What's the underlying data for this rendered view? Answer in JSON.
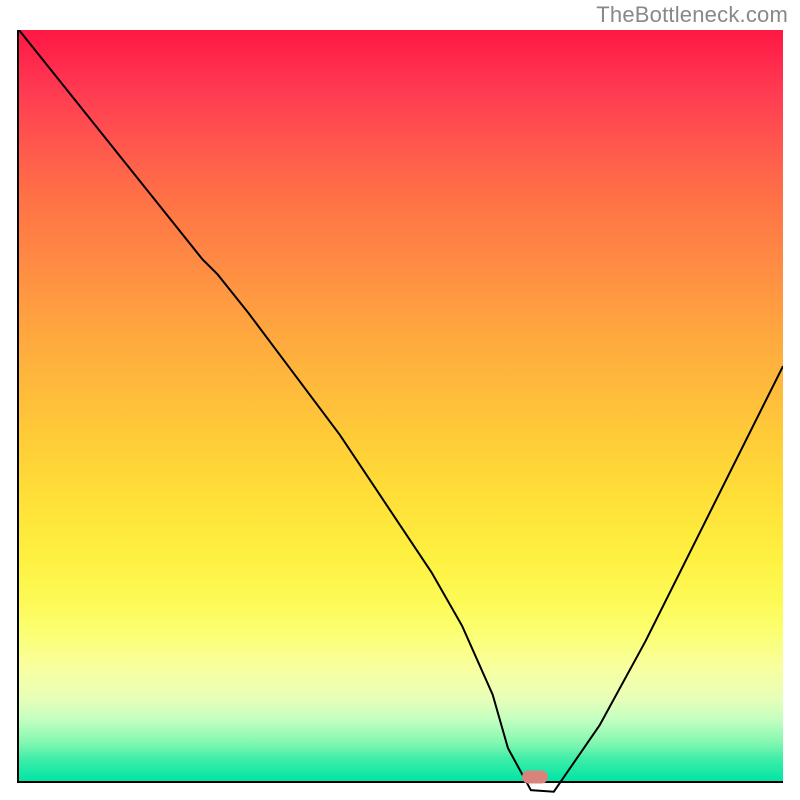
{
  "watermark": "TheBottleneck.com",
  "chart_data": {
    "type": "line",
    "title": "",
    "xlabel": "",
    "ylabel": "",
    "xlim": [
      0,
      100
    ],
    "ylim": [
      0,
      100
    ],
    "series": [
      {
        "name": "curve",
        "x": [
          0,
          8,
          16,
          24,
          26,
          30,
          36,
          42,
          48,
          54,
          58,
          62,
          64,
          67,
          70,
          76,
          82,
          88,
          94,
          100
        ],
        "y": [
          100,
          90,
          80,
          70,
          68,
          63,
          55,
          47,
          38,
          29,
          22,
          13,
          6,
          0.5,
          0.3,
          9,
          20,
          32,
          44,
          56
        ]
      }
    ],
    "marker": {
      "x": 67.5,
      "y": 0.5
    },
    "background_gradient": {
      "stops": [
        {
          "pos": 0,
          "color": "#ff1744"
        },
        {
          "pos": 50,
          "color": "#ffcb38"
        },
        {
          "pos": 80,
          "color": "#fcff70"
        },
        {
          "pos": 100,
          "color": "#00e5a5"
        }
      ]
    }
  }
}
